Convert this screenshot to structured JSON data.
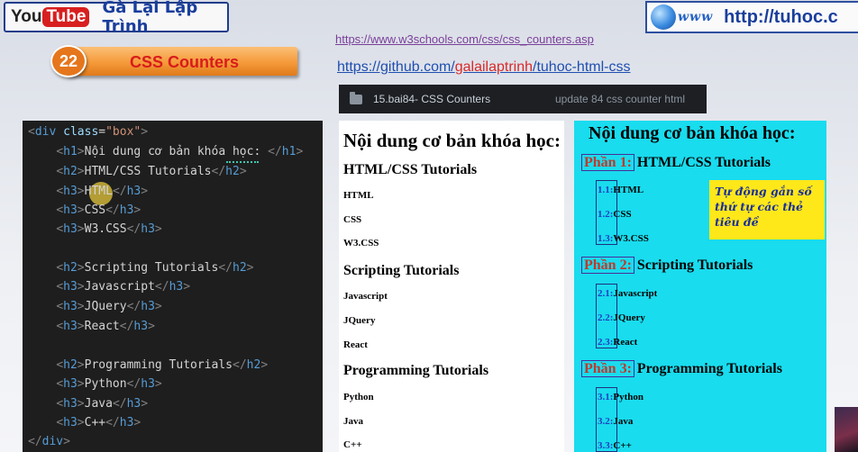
{
  "header": {
    "yt_you": "You",
    "yt_tube": "Tube",
    "channel_name": "Gà Lại Lập Trình",
    "lesson_number": "22",
    "lesson_title": "CSS Counters",
    "www_label": "www",
    "site_url": "http://tuhoc.c"
  },
  "links": {
    "w3schools": "https://www.w3schools.com/css/css_counters.asp",
    "github_prefix": "https://github.com/",
    "github_user": "galailaptrinh",
    "github_suffix": "/tuhoc-html-css"
  },
  "github_row": {
    "name": "15.bai84- CSS Counters",
    "message": "update 84 css counter html"
  },
  "code": {
    "div_open_class": "class",
    "div_open_value": "\"box\"",
    "lines": [
      "Nội dung cơ bản khóa học: ",
      "HTML/CSS Tutorials",
      "HTML",
      "CSS",
      "W3.CSS",
      "Scripting Tutorials",
      "Javascript",
      "JQuery",
      "React",
      "Programming Tutorials",
      "Python",
      "Java",
      "C++"
    ]
  },
  "preview_plain": {
    "h1": "Nội dung cơ bản khóa học:",
    "sections": [
      {
        "title": "HTML/CSS Tutorials",
        "items": [
          "HTML",
          "CSS",
          "W3.CSS"
        ]
      },
      {
        "title": "Scripting Tutorials",
        "items": [
          "Javascript",
          "JQuery",
          "React"
        ]
      },
      {
        "title": "Programming Tutorials",
        "items": [
          "Python",
          "Java",
          "C++"
        ]
      }
    ]
  },
  "preview_counter": {
    "h1": "Nội dung cơ bản khóa học:",
    "sections": [
      {
        "prefix": "Phần 1:",
        "title": "HTML/CSS Tutorials",
        "items": [
          {
            "n": "1.1:",
            "t": "HTML"
          },
          {
            "n": "1.2:",
            "t": "CSS"
          },
          {
            "n": "1.3:",
            "t": "W3.CSS"
          }
        ]
      },
      {
        "prefix": "Phần 2:",
        "title": "Scripting Tutorials",
        "items": [
          {
            "n": "2.1:",
            "t": "Javascript"
          },
          {
            "n": "2.2:",
            "t": "JQuery"
          },
          {
            "n": "2.3:",
            "t": "React"
          }
        ]
      },
      {
        "prefix": "Phần 3:",
        "title": "Programming Tutorials",
        "items": [
          {
            "n": "3.1:",
            "t": "Python"
          },
          {
            "n": "3.2:",
            "t": "Java"
          },
          {
            "n": "3.3:",
            "t": "C++"
          }
        ]
      }
    ],
    "note_lines": [
      "Tự động gắn số",
      "thứ tự các thẻ",
      "tiêu đề"
    ]
  },
  "colors": {
    "counter_bg": "#19dcee",
    "note_bg": "#ffe81a",
    "badge_orange": "#f59a3a",
    "channel_blue": "#1a3e9c"
  }
}
